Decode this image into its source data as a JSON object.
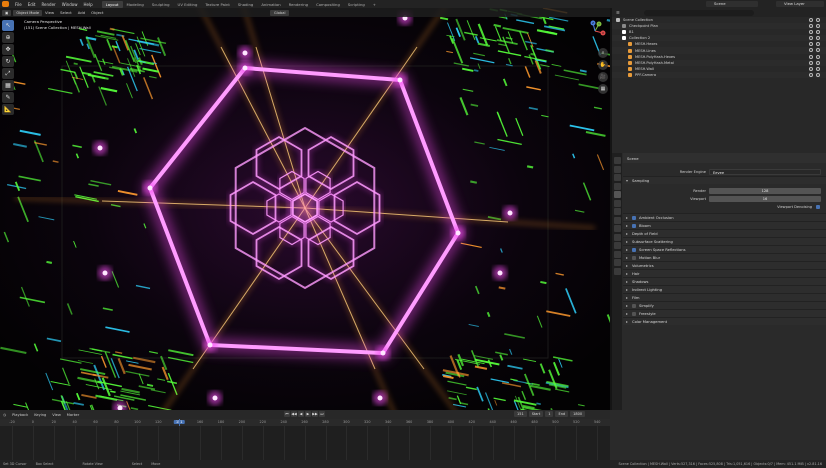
{
  "app": {
    "menu": [
      "File",
      "Edit",
      "Render",
      "Window",
      "Help"
    ],
    "workspaces": [
      "Layout",
      "Modeling",
      "Sculpting",
      "UV Editing",
      "Texture Paint",
      "Shading",
      "Animation",
      "Rendering",
      "Compositing",
      "Scripting"
    ],
    "active_workspace": "Layout",
    "add_tab": "+",
    "scene": "Scene",
    "view_layer": "View Layer"
  },
  "viewport": {
    "mode": "Object Mode",
    "menus": [
      "View",
      "Select",
      "Add",
      "Object"
    ],
    "orientation": "Global",
    "info_line1": "Camera Perspective",
    "info_line2": "(151) Scene Collection | MESH.Wall",
    "gizmo": {
      "x": "X",
      "y": "Y",
      "z": "Z"
    }
  },
  "outliner": {
    "rows": [
      {
        "label": "Scene Collection",
        "indent": 0,
        "color": "#bdbdbd"
      },
      {
        "label": "Checkpoint Plan",
        "indent": 1,
        "color": "#8a8a8a"
      },
      {
        "label": "B1",
        "indent": 1,
        "color": "#ffffff"
      },
      {
        "label": "Collection 2",
        "indent": 1,
        "color": "#ffffff"
      },
      {
        "label": "MESH.Hexes",
        "indent": 2,
        "color": "#e89b3a"
      },
      {
        "label": "MESH.Lines",
        "indent": 2,
        "color": "#e89b3a"
      },
      {
        "label": "MESH.PolyHash.Hexes",
        "indent": 2,
        "color": "#e89b3a"
      },
      {
        "label": "MESH.PolyHash.Metal",
        "indent": 2,
        "color": "#e89b3a"
      },
      {
        "label": "MESH.Wall",
        "indent": 2,
        "color": "#e89b3a"
      },
      {
        "label": "PPF.Camera",
        "indent": 2,
        "color": "#e89b3a"
      }
    ]
  },
  "properties": {
    "header": "Scene",
    "render_engine_label": "Render Engine",
    "render_engine": "Eevee",
    "sampling_label": "Sampling",
    "render_label": "Render",
    "render_samples": "128",
    "viewport_label": "Viewport",
    "viewport_samples": "16",
    "viewport_denoising": "Viewport Denoising",
    "panels": [
      {
        "label": "Ambient Occlusion",
        "check": true,
        "open": false
      },
      {
        "label": "Bloom",
        "check": true,
        "open": false
      },
      {
        "label": "Depth of Field",
        "check": null,
        "open": false
      },
      {
        "label": "Subsurface Scattering",
        "check": null,
        "open": false
      },
      {
        "label": "Screen Space Reflections",
        "check": true,
        "open": false
      },
      {
        "label": "Motion Blur",
        "check": false,
        "open": false
      },
      {
        "label": "Volumetrics",
        "check": null,
        "open": false
      },
      {
        "label": "Hair",
        "check": null,
        "open": false
      },
      {
        "label": "Shadows",
        "check": null,
        "open": false
      },
      {
        "label": "Indirect Lighting",
        "check": null,
        "open": false
      },
      {
        "label": "Film",
        "check": null,
        "open": false
      },
      {
        "label": "Simplify",
        "check": false,
        "open": false
      },
      {
        "label": "Freestyle",
        "check": false,
        "open": false
      },
      {
        "label": "Color Management",
        "check": null,
        "open": false
      }
    ]
  },
  "timeline": {
    "menus": [
      "Playback",
      "Keying",
      "View",
      "Marker"
    ],
    "current_frame": "151",
    "start_label": "Start",
    "start": "1",
    "end_label": "End",
    "end": "1800",
    "ruler": [
      "-20",
      "0",
      "20",
      "40",
      "60",
      "80",
      "100",
      "120",
      "151",
      "160",
      "180",
      "200",
      "220",
      "240",
      "260",
      "280",
      "300",
      "320",
      "340",
      "360",
      "380",
      "400",
      "420",
      "440",
      "460",
      "480",
      "500",
      "520",
      "540"
    ],
    "playhead_frame": 151
  },
  "statusbar": {
    "items": [
      "Set 3D Cursor",
      "Box Select",
      "Rotate View",
      "Select",
      "Move"
    ],
    "stats": "Scene Collection | MESH.Wall | Verts:527,316 | Faces:525,808 | Tris:1,051,616 | Objects:0/7 | Mem: 451.1 MiB | v2.81.16"
  },
  "colors": {
    "accent": "#4772b3",
    "neon_magenta": "#f34cf0",
    "neon_orange": "#ff9a2e",
    "neon_green": "#56ff3a"
  }
}
